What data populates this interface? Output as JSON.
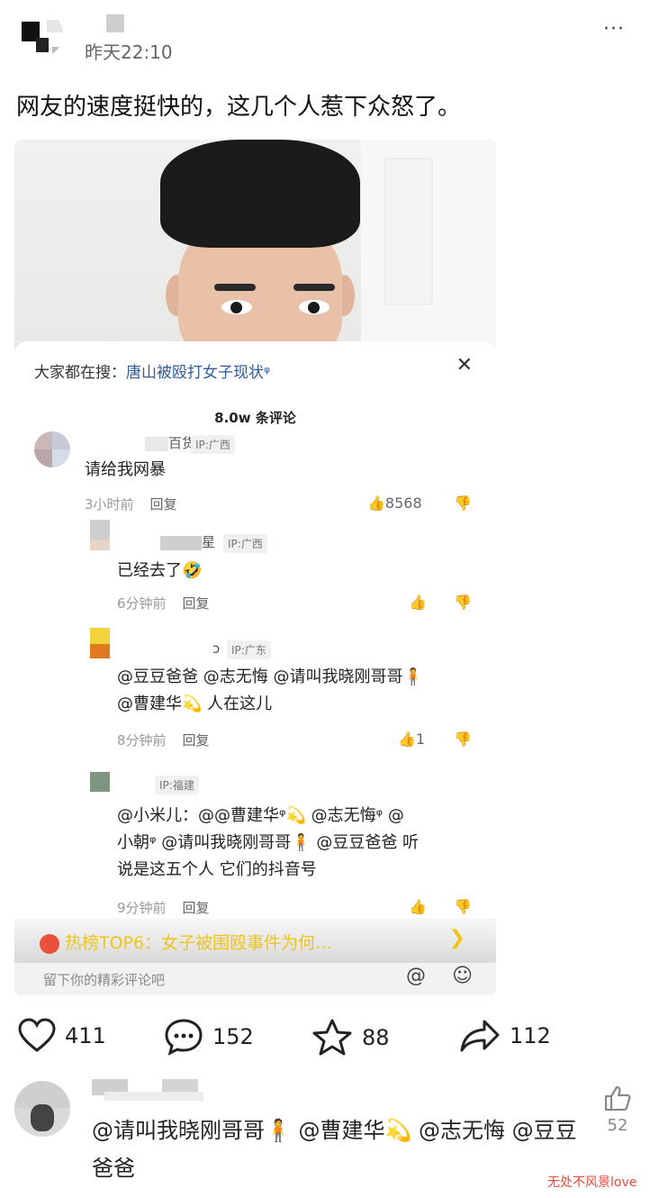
{
  "post": {
    "time": "昨天22:10",
    "more": "···",
    "text": "网友的速度挺快的，这几个人惹下众怒了。"
  },
  "screenshot": {
    "search_prefix": "大家都在搜：",
    "search_link": "唐山被殴打女子现状ᵠ",
    "close": "✕",
    "comment_count": "8.0w 条评论",
    "comments": [
      {
        "name_tail": "百货",
        "ip": "IP:广西",
        "text": "请给我网暴",
        "time": "3小时前",
        "reply": "回复",
        "likes": "8568"
      },
      {
        "name_tail": "星",
        "ip": "IP:广西",
        "text": "已经去了🤣",
        "time": "6分钟前",
        "reply": "回复",
        "likes": ""
      },
      {
        "name_tail": "ↄ",
        "ip": "IP:广东",
        "text_line1": "@豆豆爸爸 @志无悔 @请叫我晓刚哥哥🧍",
        "text_line2": "@曹建华💫 人在这儿",
        "time": "8分钟前",
        "reply": "回复",
        "likes": "1"
      },
      {
        "ip": "IP:福建",
        "text_line1": "@小米儿：@@曹建华ᵠ💫 @志无悔ᵠ @",
        "text_line2": "小朝ᵠ @请叫我晓刚哥哥🧍 @豆豆爸爸 听",
        "text_line3": "说是这五个人  它们的抖音号",
        "time": "9分钟前",
        "reply": "回复"
      }
    ],
    "hot_bar": "热榜TOP6：女子被围殴事件为何…",
    "hot_arrow": "❯",
    "input_placeholder": "留下你的精彩评论吧",
    "at_icon": "@",
    "emoji_icon": "☺"
  },
  "actions": {
    "like_count": "411",
    "comment_count": "152",
    "star_count": "88",
    "share_count": "112"
  },
  "bottom_comment": {
    "text": "@请叫我晓刚哥哥🧍 @曹建华💫 @志无悔 @豆豆爸爸",
    "likes": "52"
  },
  "watermark": "无处不风景love"
}
